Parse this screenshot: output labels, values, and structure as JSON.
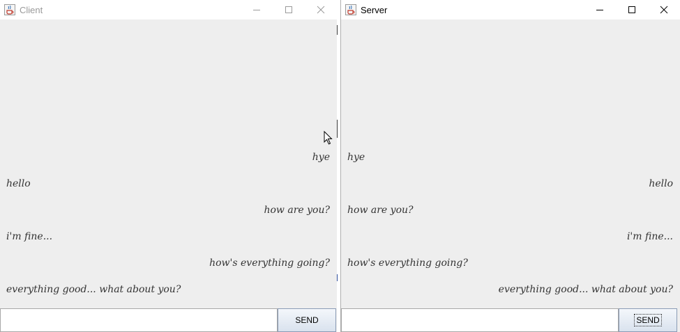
{
  "client": {
    "title": "Client",
    "icon": "java-cup-icon",
    "send_label": "SEND",
    "input_value": "",
    "messages": [
      {
        "text": "hye",
        "side": "right"
      },
      {
        "text": "hello",
        "side": "left"
      },
      {
        "text": "how are you?",
        "side": "right"
      },
      {
        "text": "i'm fine...",
        "side": "left"
      },
      {
        "text": "how's everything going?",
        "side": "right"
      },
      {
        "text": "everything good... what about you?",
        "side": "left"
      }
    ]
  },
  "server": {
    "title": "Server",
    "icon": "java-cup-icon",
    "send_label": "SEND",
    "input_value": "",
    "messages": [
      {
        "text": "hye",
        "side": "left"
      },
      {
        "text": "hello",
        "side": "right"
      },
      {
        "text": "how are you?",
        "side": "left"
      },
      {
        "text": "i'm fine...",
        "side": "right"
      },
      {
        "text": "how's everything going?",
        "side": "left"
      },
      {
        "text": "everything good... what about you?",
        "side": "right"
      }
    ]
  },
  "colors": {
    "window_bg": "#eeeeee",
    "titlebar_bg": "#ffffff",
    "inactive_title": "#9a9a9a",
    "message_text": "#333333"
  }
}
